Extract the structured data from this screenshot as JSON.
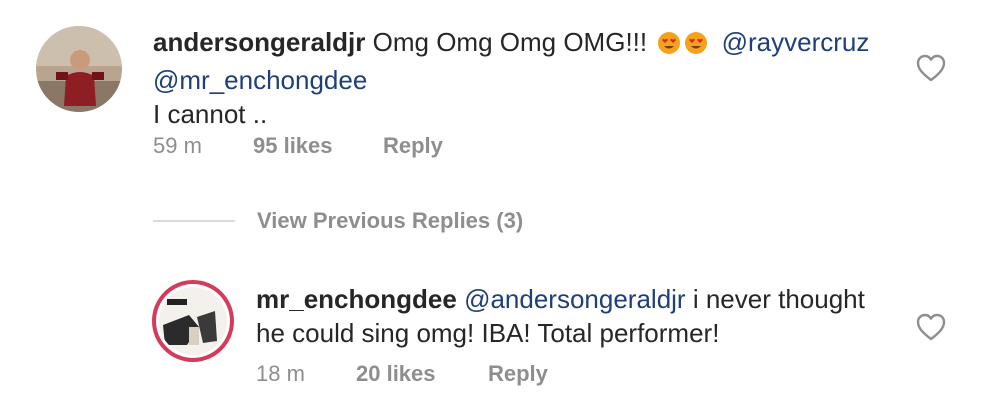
{
  "comment": {
    "username": "andersongeraldjr",
    "text_main": "Omg Omg Omg OMG!!!",
    "emoji_1": "heart-eyes-emoji",
    "emoji_2": "heart-eyes-emoji",
    "mention_1": "@rayvercruz",
    "mention_2": "@mr_enchongdee",
    "text_line3": "I cannot ..",
    "time": "59 m",
    "likes": "95 likes",
    "reply": "Reply",
    "like_icon": "heart-outline-icon"
  },
  "view_previous": {
    "label": "View Previous Replies (3)"
  },
  "reply_comment": {
    "username": "mr_enchongdee",
    "mention": "@andersongeraldjr",
    "text_rest": "i never thought",
    "text_line2": "he could sing omg! IBA! Total performer!",
    "time": "18 m",
    "likes": "20 likes",
    "reply": "Reply",
    "like_icon": "heart-outline-icon"
  },
  "colors": {
    "mention": "#1f3f7a",
    "muted": "#8e8e8e",
    "story_ring": "#d63a5a"
  }
}
